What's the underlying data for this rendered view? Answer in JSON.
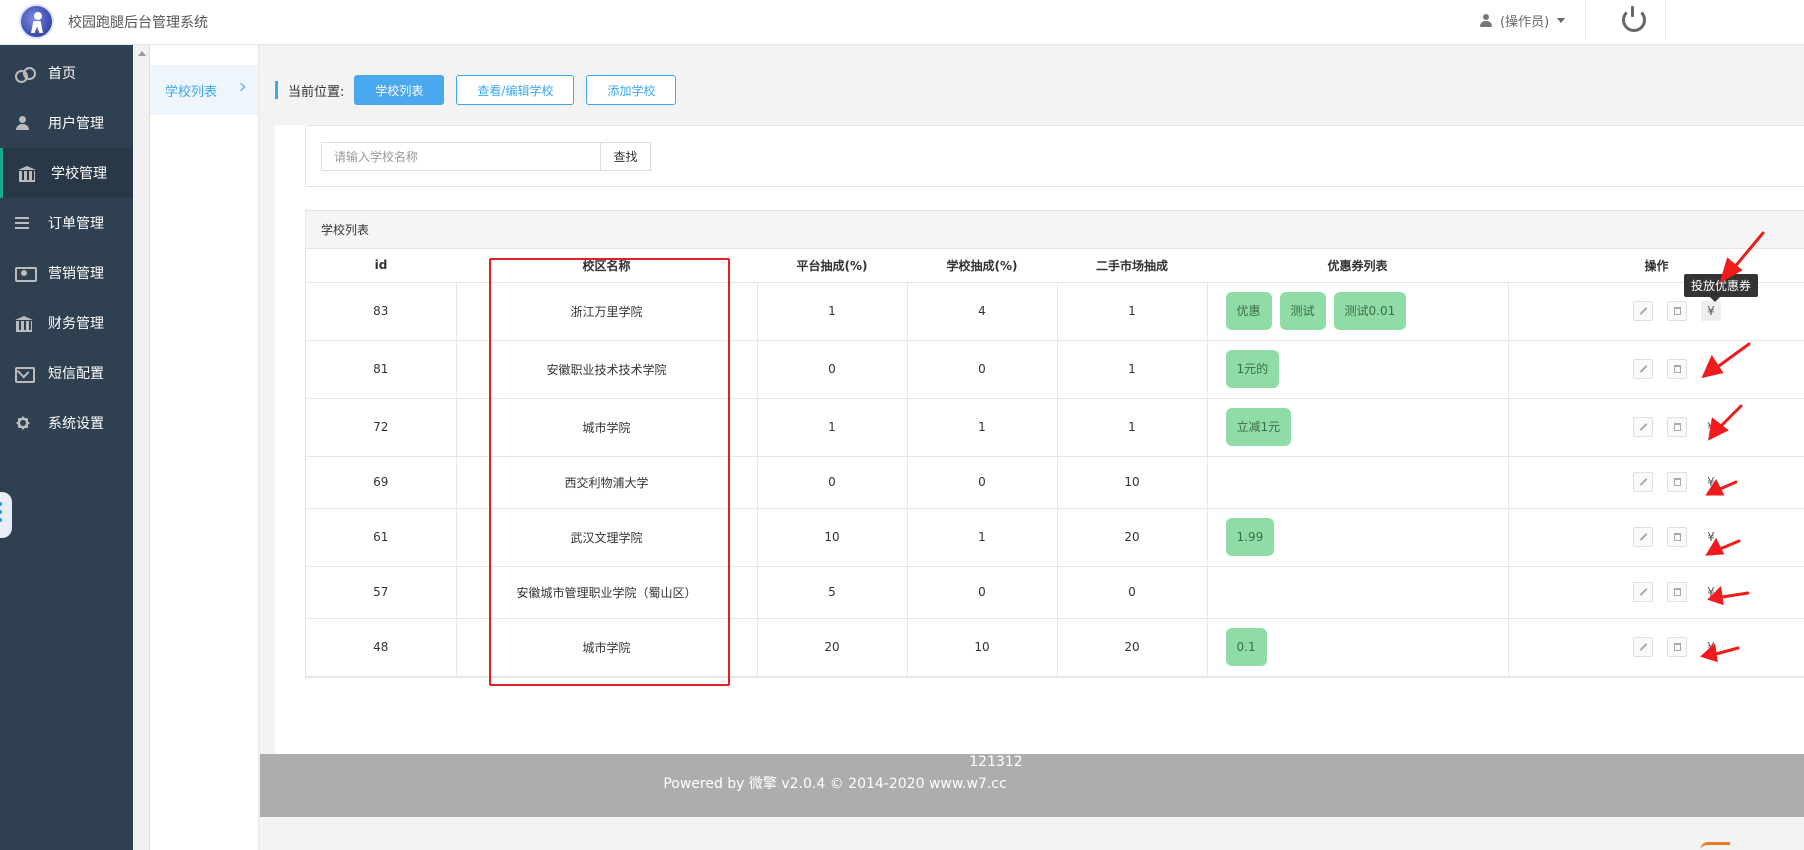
{
  "header": {
    "app_title": "校园跑腿后台管理系统",
    "user_label": "(操作员)",
    "logo_icon": "runner-logo",
    "power_icon": "power-icon"
  },
  "sidebar": {
    "items": [
      {
        "label": "首页",
        "icon": "home-icon"
      },
      {
        "label": "用户管理",
        "icon": "user-icon"
      },
      {
        "label": "学校管理",
        "icon": "bank-icon",
        "active": true
      },
      {
        "label": "订单管理",
        "icon": "list-icon"
      },
      {
        "label": "营销管理",
        "icon": "money-icon"
      },
      {
        "label": "财务管理",
        "icon": "bank-icon"
      },
      {
        "label": "短信配置",
        "icon": "mail-icon"
      },
      {
        "label": "系统设置",
        "icon": "gear-icon"
      }
    ]
  },
  "subnav": {
    "item": "学校列表"
  },
  "breadcrumb": {
    "label": "当前位置:",
    "tabs": [
      "学校列表",
      "查看/编辑学校",
      "添加学校"
    ]
  },
  "search": {
    "placeholder": "请输入学校名称",
    "button": "查找"
  },
  "table": {
    "title": "学校列表",
    "columns": [
      "id",
      "校区名称",
      "平台抽成(%)",
      "学校抽成(%)",
      "二手市场抽成",
      "优惠券列表",
      "操作"
    ],
    "rows": [
      {
        "id": "83",
        "name": "浙江万里学院",
        "platform": "1",
        "school": "4",
        "market": "1",
        "coupons": [
          "优惠",
          "测试",
          "测试0.01"
        ]
      },
      {
        "id": "81",
        "name": "安徽职业技术技术学院",
        "platform": "0",
        "school": "0",
        "market": "1",
        "coupons": [
          "1元的"
        ]
      },
      {
        "id": "72",
        "name": "城市学院",
        "platform": "1",
        "school": "1",
        "market": "1",
        "coupons": [
          "立减1元"
        ]
      },
      {
        "id": "69",
        "name": "西交利物浦大学",
        "platform": "0",
        "school": "0",
        "market": "10",
        "coupons": []
      },
      {
        "id": "61",
        "name": "武汉文理学院",
        "platform": "10",
        "school": "1",
        "market": "20",
        "coupons": [
          "1.99"
        ]
      },
      {
        "id": "57",
        "name": "安徽城市管理职业学院（蜀山区）",
        "platform": "5",
        "school": "0",
        "market": "0",
        "coupons": []
      },
      {
        "id": "48",
        "name": "城市学院",
        "platform": "20",
        "school": "10",
        "market": "20",
        "coupons": [
          "0.1"
        ]
      }
    ],
    "op_yen": "¥"
  },
  "tooltip": "投放优惠券",
  "footer": {
    "line1": "121312",
    "line2": "Powered by 微擎 v2.0.4 © 2014-2020 www.w7.cc"
  },
  "colors": {
    "sidebar_bg": "#2f4050",
    "accent": "#4aa8ee",
    "tag_bg": "#8fdca6",
    "annotation_red": "#e51f1f"
  }
}
